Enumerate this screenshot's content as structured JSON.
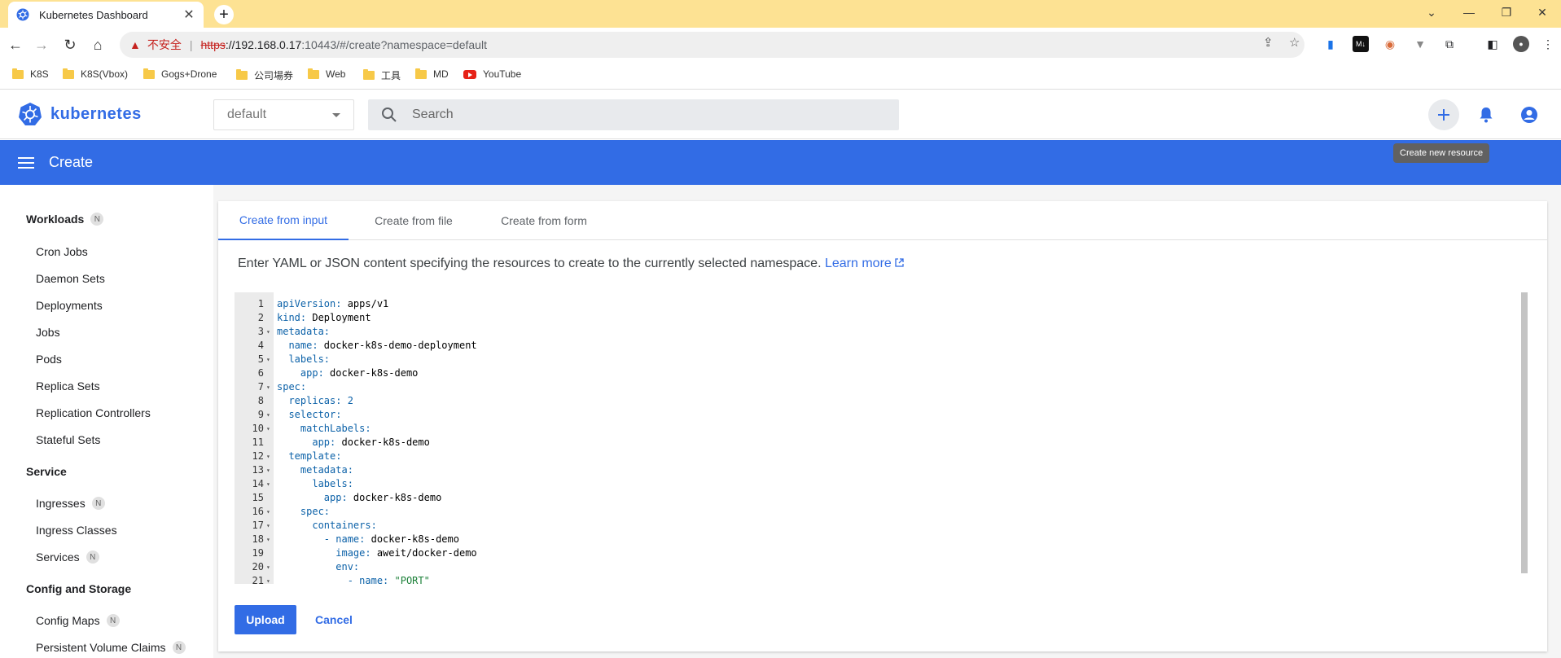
{
  "browser": {
    "tab_title": "Kubernetes Dashboard",
    "url": {
      "insecure_label": "不安全",
      "scheme": "https",
      "host": "://192.168.0.17",
      "path": ":10443/#/create?namespace=default"
    },
    "bookmarks": [
      "K8S",
      "K8S(Vbox)",
      "Gogs+Drone",
      "公司場券",
      "Web",
      "工具",
      "MD",
      "YouTube"
    ]
  },
  "header": {
    "brand": "kubernetes",
    "namespace": "default",
    "search_placeholder": "Search",
    "tooltip": "Create new resource"
  },
  "appbar": {
    "title": "Create"
  },
  "sidebar": {
    "groups": [
      {
        "label": "Workloads",
        "badge": "N"
      },
      {
        "label": "Service"
      },
      {
        "label": "Config and Storage"
      }
    ],
    "items": [
      {
        "label": "Cron Jobs"
      },
      {
        "label": "Daemon Sets"
      },
      {
        "label": "Deployments"
      },
      {
        "label": "Jobs"
      },
      {
        "label": "Pods"
      },
      {
        "label": "Replica Sets"
      },
      {
        "label": "Replication Controllers"
      },
      {
        "label": "Stateful Sets"
      },
      {
        "label": "Ingresses",
        "badge": "N"
      },
      {
        "label": "Ingress Classes"
      },
      {
        "label": "Services",
        "badge": "N"
      },
      {
        "label": "Config Maps",
        "badge": "N"
      },
      {
        "label": "Persistent Volume Claims",
        "badge": "N"
      }
    ]
  },
  "create": {
    "tabs": [
      "Create from input",
      "Create from file",
      "Create from form"
    ],
    "active_tab": "Create from input",
    "description": "Enter YAML or JSON content specifying the resources to create to the currently selected namespace.",
    "learn_more": "Learn more",
    "upload_label": "Upload",
    "cancel_label": "Cancel"
  },
  "editor": {
    "lines": [
      "apiVersion: apps/v1",
      "kind: Deployment",
      "metadata:",
      "  name: docker-k8s-demo-deployment",
      "  labels:",
      "    app: docker-k8s-demo",
      "spec:",
      "  replicas: 2",
      "  selector:",
      "    matchLabels:",
      "      app: docker-k8s-demo",
      "  template:",
      "    metadata:",
      "      labels:",
      "        app: docker-k8s-demo",
      "    spec:",
      "      containers:",
      "        - name: docker-k8s-demo",
      "          image: aweit/docker-demo",
      "          env:",
      "            - name: \"PORT\""
    ],
    "foldable_lines": [
      3,
      5,
      7,
      9,
      10,
      12,
      13,
      14,
      16,
      17,
      18,
      20,
      21
    ]
  },
  "colors": {
    "brand": "#326ce5",
    "titlebar": "#fde293"
  },
  "icons": [
    "kubernetes-favicon",
    "back-icon",
    "forward-icon",
    "reload-icon",
    "home-icon",
    "warning-icon",
    "share-icon",
    "star-icon",
    "search-icon",
    "plus-icon",
    "bell-icon",
    "account-icon",
    "menu-icon",
    "external-link-icon",
    "folder-icon",
    "youtube-icon"
  ]
}
